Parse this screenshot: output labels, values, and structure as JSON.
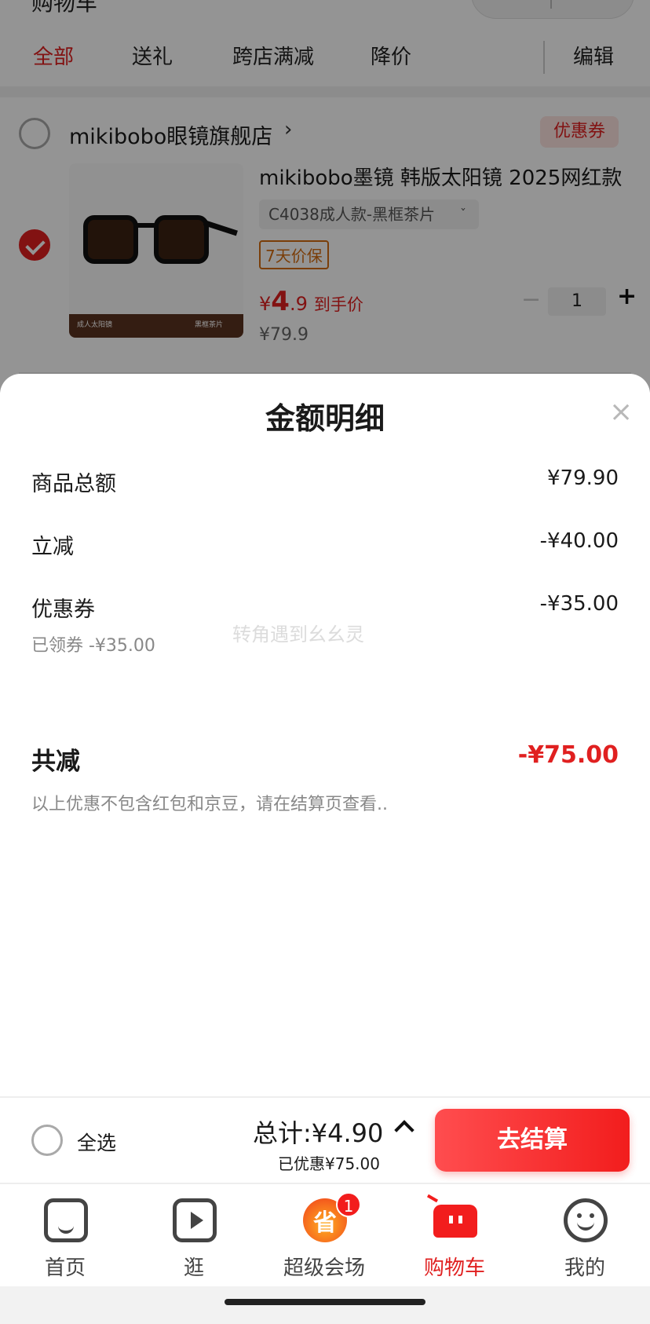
{
  "top_stub": "购物车",
  "filter_tabs": [
    {
      "label": "全部"
    },
    {
      "label": "送礼"
    },
    {
      "label": "跨店满减"
    },
    {
      "label": "降价"
    }
  ],
  "edit_label": "编辑",
  "store": {
    "name": "mikibobo眼镜旗舰店",
    "arrow": "›",
    "coupon_tag": "优惠券"
  },
  "product": {
    "title": "mikibobo墨镜 韩版太阳镜 2025网红款",
    "spec": "C4038成人款-黑框茶片",
    "spec_chevron": "ˇ",
    "guarantee": "7天价保",
    "price_yen": "¥",
    "price_int": "4",
    "price_dec": ".9",
    "price_tag": "到手价",
    "orig_price": "¥79.9",
    "qty": "1",
    "img_band_left": "成人太阳镜",
    "img_band_right": "黑框茶片",
    "checked": true
  },
  "sheet": {
    "title": "金额明细",
    "close": "×",
    "rows": [
      {
        "label": "商品总额",
        "value": "¥79.90"
      },
      {
        "label": "立减",
        "value": "-¥40.00"
      },
      {
        "label": "优惠券",
        "value": "-¥35.00",
        "sub": "已领券 -¥35.00"
      }
    ],
    "total_label": "共减",
    "total_value": "-¥75.00",
    "note": "以上优惠不包含红包和京豆，请在结算页查看..",
    "watermark": "转角遇到幺幺灵"
  },
  "checkout": {
    "select_all": "全选",
    "total": "总计:¥4.90",
    "saved": "已优惠¥75.00",
    "button": "去结算"
  },
  "tabbar": [
    {
      "label": "首页",
      "icon": "home-icon"
    },
    {
      "label": "逛",
      "icon": "play-icon"
    },
    {
      "label": "超级会场",
      "icon": "super-venue-icon",
      "icon_text": "省",
      "badge": "1"
    },
    {
      "label": "购物车",
      "icon": "cart-icon",
      "active": true
    },
    {
      "label": "我的",
      "icon": "profile-icon"
    }
  ],
  "colors": {
    "accent": "#e02020",
    "checkout_button": "#f21d1d",
    "muted_text": "#888888"
  }
}
